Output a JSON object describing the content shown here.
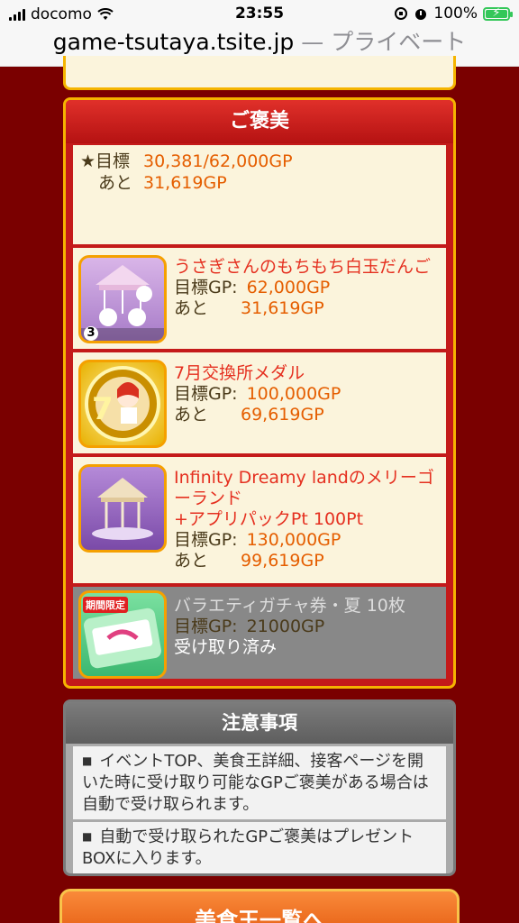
{
  "status_bar": {
    "carrier": "docomo",
    "time": "23:55",
    "battery": "100%"
  },
  "address_bar": {
    "domain": "game-tsutaya.tsite.jp",
    "private_label": "— プライベート"
  },
  "reward": {
    "header": "ご褒美",
    "summary": {
      "goal_label": "★目標",
      "goal_value": "30,381/62,000GP",
      "remain_label": "あと",
      "remain_value": "31,619GP"
    },
    "items": [
      {
        "name": "うさぎさんのもちもち白玉だんご",
        "goal_label": "目標GP:",
        "goal_value": "62,000GP",
        "remain_label": "あと",
        "remain_value": "31,619GP",
        "badge": "3"
      },
      {
        "name": "7月交換所メダル",
        "goal_label": "目標GP:",
        "goal_value": "100,000GP",
        "remain_label": "あと",
        "remain_value": "69,619GP",
        "badge": "7"
      },
      {
        "name": "Infinity Dreamy landのメリーゴーランド",
        "extra": "+アプリパックPt 100Pt",
        "goal_label": "目標GP:",
        "goal_value": "130,000GP",
        "remain_label": "あと",
        "remain_value": "99,619GP"
      },
      {
        "name": "バラエティガチャ券・夏 10枚",
        "goal_label": "目標GP:",
        "goal_value": "21000GP",
        "status": "受け取り済み",
        "ticket_tag": "期間限定"
      }
    ]
  },
  "notes": {
    "header": "注意事項",
    "items": [
      "イベントTOP、美食王詳細、接客ページを開いた時に受け取り可能なGPご褒美がある場合は自動で受け取られます。",
      "自動で受け取られたGPご褒美はプレゼントBOXに入ります。"
    ]
  },
  "bottom_button": {
    "label": "美食王一覧へ"
  },
  "colors": {
    "background": "#7a0000",
    "panel_red": "#c41a1a",
    "gold_border": "#f5b400",
    "cream": "#fbf4dc",
    "value_orange": "#e55e00",
    "name_red": "#e53020"
  }
}
